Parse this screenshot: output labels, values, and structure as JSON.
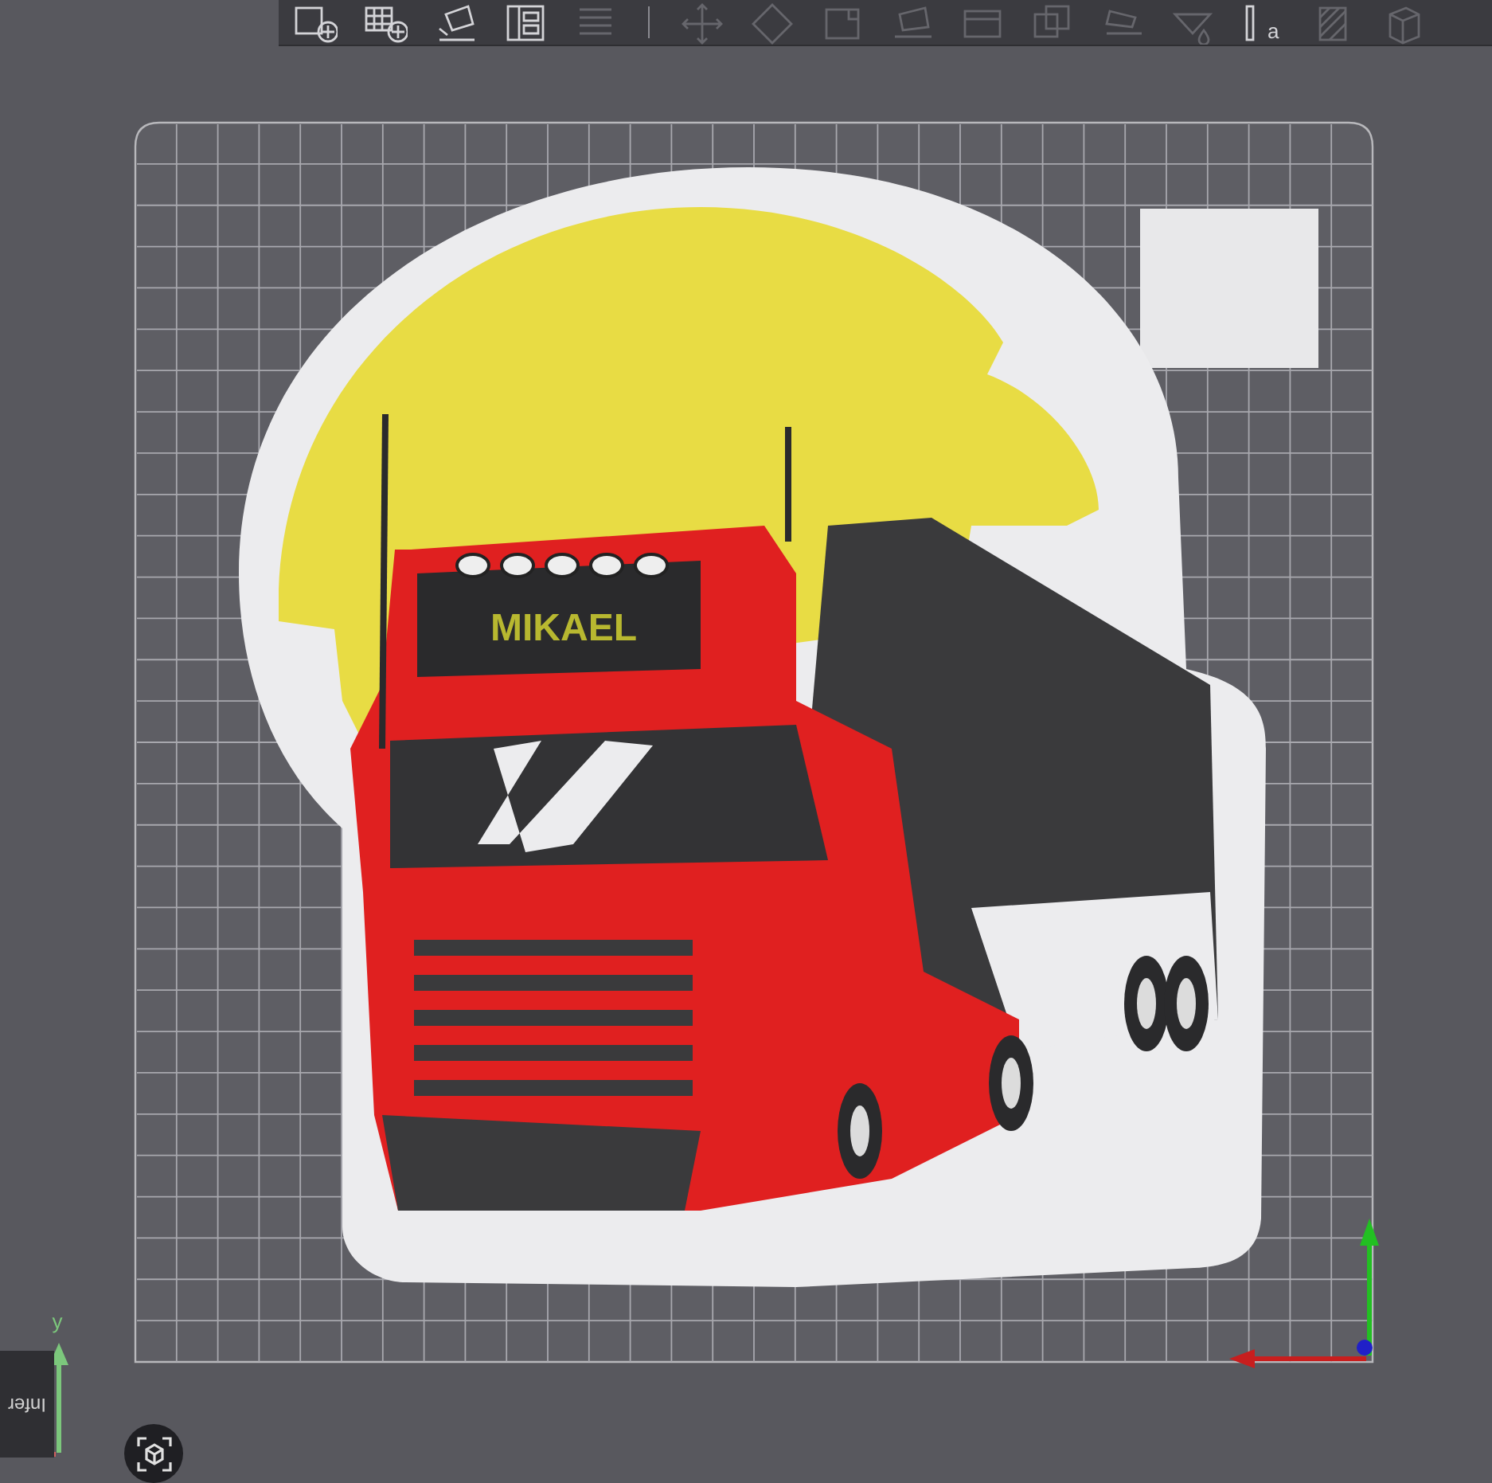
{
  "toolbar": [
    {
      "kind": "add",
      "disabled": false
    },
    {
      "kind": "plate",
      "disabled": false
    },
    {
      "kind": "orient",
      "disabled": false
    },
    {
      "kind": "arrange",
      "disabled": false
    },
    {
      "kind": "layers",
      "disabled": true
    },
    {
      "kind": "separator"
    },
    {
      "kind": "move",
      "disabled": true
    },
    {
      "kind": "rotate",
      "disabled": true
    },
    {
      "kind": "scale",
      "disabled": true
    },
    {
      "kind": "flat",
      "disabled": true
    },
    {
      "kind": "cut",
      "disabled": true
    },
    {
      "kind": "boolean",
      "disabled": true
    },
    {
      "kind": "paint",
      "disabled": true
    },
    {
      "kind": "seam",
      "disabled": true
    },
    {
      "kind": "text",
      "disabled": false,
      "label": "a"
    },
    {
      "kind": "support",
      "disabled": true
    },
    {
      "kind": "assembly",
      "disabled": true
    }
  ],
  "plate": {
    "model_text": "MIKAEL"
  },
  "axes": {
    "y_label": "y"
  },
  "info_panel": {
    "text": "Infer"
  }
}
